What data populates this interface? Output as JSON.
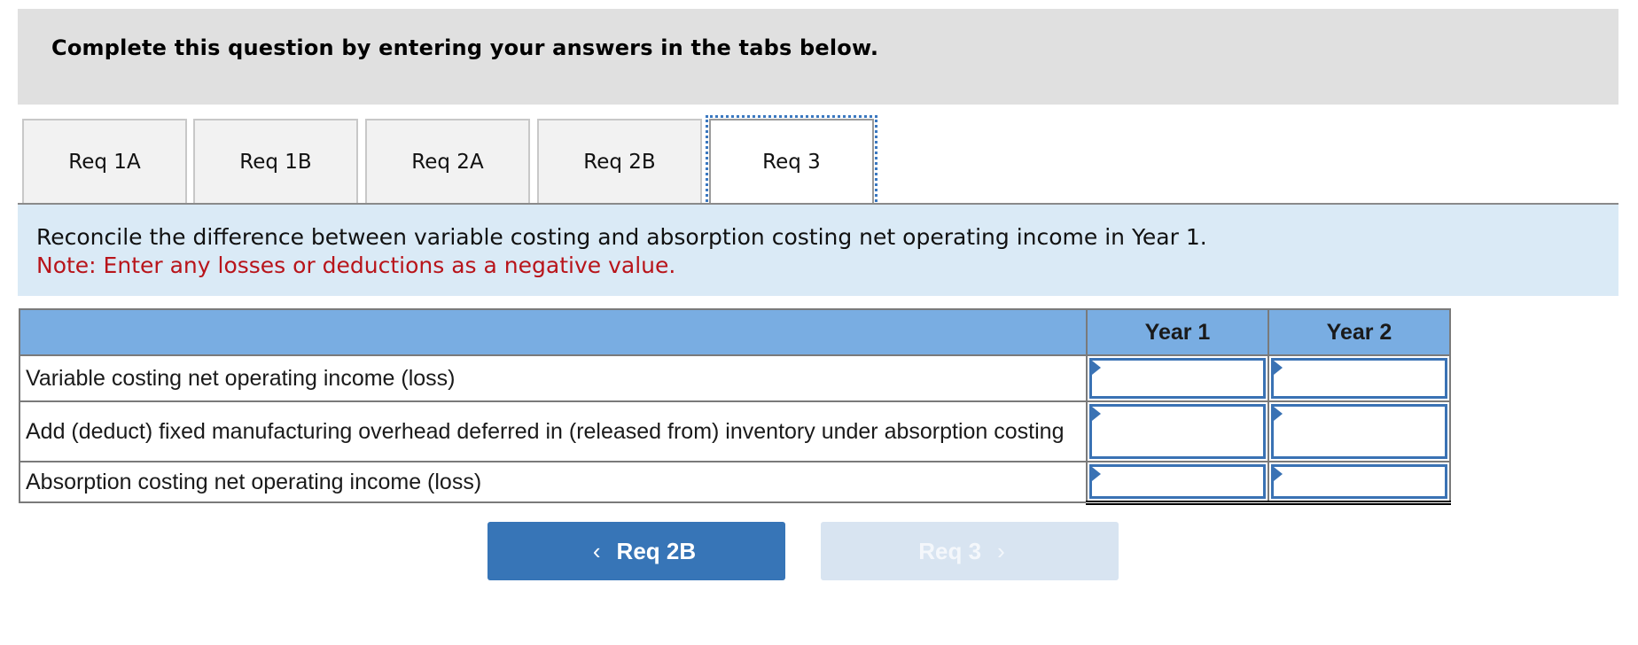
{
  "header": {
    "title": "Complete this question by entering your answers in the tabs below."
  },
  "tabs": [
    {
      "label": "Req 1A",
      "active": false
    },
    {
      "label": "Req 1B",
      "active": false
    },
    {
      "label": "Req 2A",
      "active": false
    },
    {
      "label": "Req 2B",
      "active": false
    },
    {
      "label": "Req 3",
      "active": true
    }
  ],
  "instructions": {
    "text": "Reconcile the difference between variable costing and absorption costing net operating income in Year 1.",
    "note": "Note: Enter any losses or deductions as a negative value."
  },
  "table": {
    "columns": [
      "",
      "Year 1",
      "Year 2"
    ],
    "rows": [
      {
        "label": "Variable costing net operating income (loss)",
        "year1": "",
        "year2": ""
      },
      {
        "label": "Add (deduct) fixed manufacturing overhead deferred in (released from) inventory under absorption costing",
        "year1": "",
        "year2": ""
      },
      {
        "label": "Absorption costing net operating income (loss)",
        "year1": "",
        "year2": ""
      }
    ]
  },
  "navigation": {
    "prev_label": "Req 2B",
    "next_label": "Req 3",
    "prev_icon": "chevron-left-icon",
    "next_icon": "chevron-right-icon",
    "next_disabled": true
  },
  "colors": {
    "accent": "#3775b7",
    "table_header": "#79ade2",
    "note_red": "#b8141a",
    "band_bg": "#daeaf6"
  }
}
